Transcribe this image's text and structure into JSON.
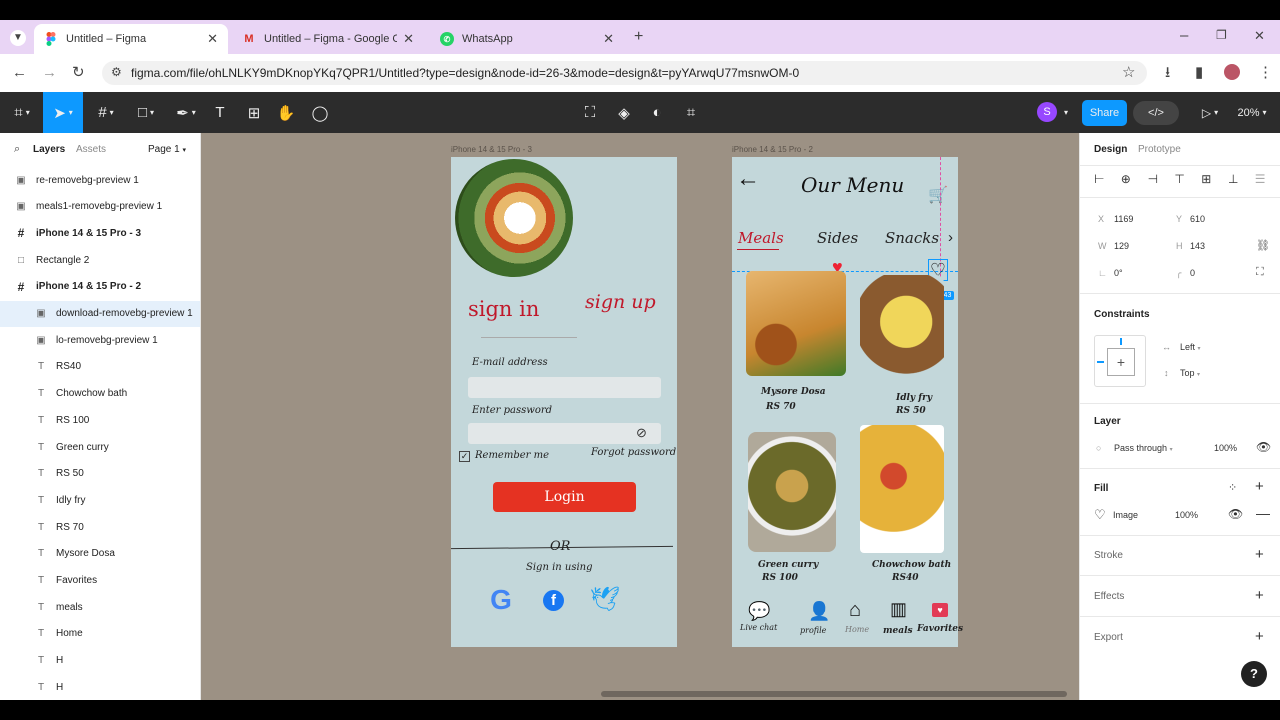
{
  "browser": {
    "tabs": [
      {
        "label": "Untitled – Figma",
        "icon": "figma-icon"
      },
      {
        "label": "Untitled – Figma - Google Chrom",
        "icon": "gmail-icon"
      },
      {
        "label": "WhatsApp",
        "icon": "whatsapp-icon"
      }
    ],
    "url": "figma.com/file/ohLNLKY9mDKnopYKq7QPR1/Untitled?type=design&node-id=26-3&mode=design&t=pyYArwqU77msnwOM-0"
  },
  "toolbar": {
    "avatar_letter": "S",
    "share_label": "Share",
    "zoom": "20%"
  },
  "left_panel": {
    "tabs": [
      "Layers",
      "Assets"
    ],
    "page": "Page 1",
    "layers": [
      {
        "name": "re-removebg-preview 1",
        "icon": "image-icon"
      },
      {
        "name": "meals1-removebg-preview 1",
        "icon": "image-icon"
      },
      {
        "name": "iPhone 14 & 15 Pro - 3",
        "icon": "frame-icon"
      },
      {
        "name": "Rectangle 2",
        "icon": "rectangle-icon"
      },
      {
        "name": "iPhone 14 & 15 Pro - 2",
        "icon": "frame-icon"
      },
      {
        "name": "download-removebg-preview 1",
        "icon": "image-icon"
      },
      {
        "name": "lo-removebg-preview 1",
        "icon": "image-icon"
      },
      {
        "name": "RS40",
        "icon": "text-icon"
      },
      {
        "name": "Chowchow bath",
        "icon": "text-icon"
      },
      {
        "name": "RS 100",
        "icon": "text-icon"
      },
      {
        "name": "Green curry",
        "icon": "text-icon"
      },
      {
        "name": "RS 50",
        "icon": "text-icon"
      },
      {
        "name": "Idly fry",
        "icon": "text-icon"
      },
      {
        "name": "RS 70",
        "icon": "text-icon"
      },
      {
        "name": "Mysore Dosa",
        "icon": "text-icon"
      },
      {
        "name": "Favorites",
        "icon": "text-icon"
      },
      {
        "name": "meals",
        "icon": "text-icon"
      },
      {
        "name": "Home",
        "icon": "text-icon"
      },
      {
        "name": "H",
        "icon": "text-icon"
      },
      {
        "name": "H",
        "icon": "text-icon"
      }
    ]
  },
  "signin_frame": {
    "label": "iPhone 14 & 15 Pro - 3",
    "signin": "sign in",
    "signup": "sign up",
    "email_label": "E-mail address",
    "password_label": "Enter password",
    "remember": "Remember me",
    "forgot": "Forgot password",
    "login": "Login",
    "or": "OR",
    "signin_using": "Sign in using"
  },
  "menu_frame": {
    "label": "iPhone 14 & 15 Pro - 2",
    "title": "Our Menu",
    "tabs": [
      "Meals",
      "Sides",
      "Snacks"
    ],
    "selection_size": "129 × 143",
    "items": [
      {
        "name": "Mysore Dosa",
        "price": "RS 70"
      },
      {
        "name": "Idly fry",
        "price": "RS 50"
      },
      {
        "name": "Green curry",
        "price": "RS 100"
      },
      {
        "name": "Chowchow bath",
        "price": "RS40"
      }
    ],
    "nav": [
      {
        "label": "Live chat",
        "icon": "chat-icon"
      },
      {
        "label": "profile",
        "icon": "profile-icon"
      },
      {
        "label": "Home",
        "icon": "home-icon"
      },
      {
        "label": "meals",
        "icon": "menu-icon"
      },
      {
        "label": "Favorites",
        "icon": "favorite-icon"
      }
    ]
  },
  "right_panel": {
    "tabs": [
      "Design",
      "Prototype"
    ],
    "x_label": "X",
    "x": "1169",
    "y_label": "Y",
    "y": "610",
    "w_label": "W",
    "w": "129",
    "h_label": "H",
    "h": "143",
    "rotation": "0°",
    "radius": "0",
    "constraints_title": "Constraints",
    "constraint_h": "Left",
    "constraint_v": "Top",
    "layer_title": "Layer",
    "blend": "Pass through",
    "opacity": "100%",
    "fill_title": "Fill",
    "fill_type": "Image",
    "fill_opacity": "100%",
    "stroke_title": "Stroke",
    "effects_title": "Effects",
    "export_title": "Export"
  },
  "colors": {
    "accent": "#0d99ff",
    "canvas": "#9c9184",
    "frame": "#c3d7da",
    "login": "#e53222",
    "signin_red": "#c0182a"
  }
}
